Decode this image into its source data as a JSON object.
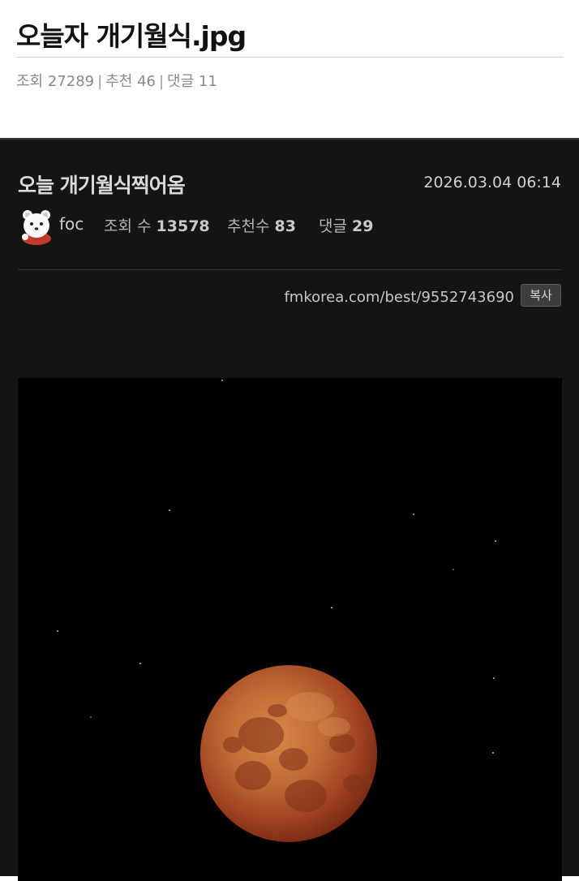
{
  "post": {
    "title": "오늘자 개기월식.jpg",
    "views_label": "조회",
    "views": "27289",
    "likes_label": "추천",
    "likes": "46",
    "comments_label": "댓글",
    "comments": "11",
    "separator": "|"
  },
  "screenshot": {
    "title": "오늘 개기월식찍어옴",
    "date": "2026.03.04 06:14",
    "author": "foc",
    "views_label": "조회 수",
    "views": "13578",
    "likes_label": "추천수",
    "likes": "83",
    "comments_label": "댓글",
    "comments": "29",
    "url": "fmkorea.com/best/9552743690",
    "copy_label": "복사",
    "background": "#141414",
    "image": {
      "subject": "blood-moon",
      "moon_color": "#b8582c"
    }
  },
  "icons": {
    "avatar": "polar-bear-avatar-icon"
  }
}
